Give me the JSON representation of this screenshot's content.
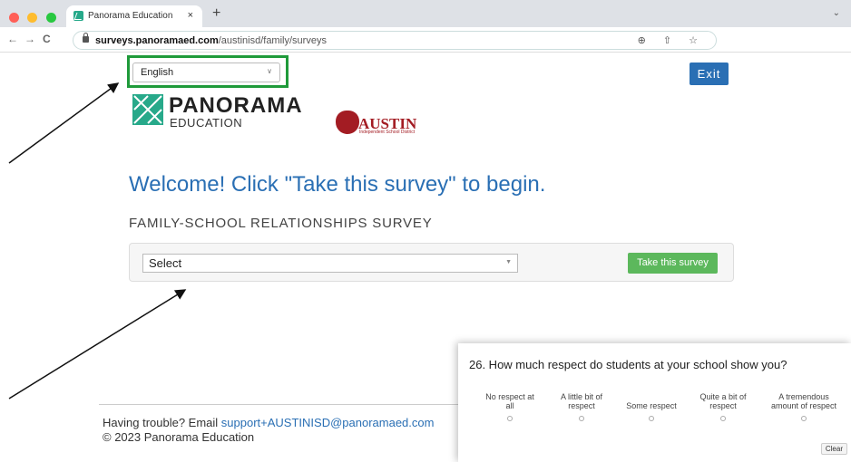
{
  "browser": {
    "tab_title": "Panorama Education",
    "tab_close": "×",
    "new_tab": "+",
    "url_host": "surveys.panoramaed.com",
    "url_path": "/austinisd/family/surveys",
    "nav_back": "←",
    "nav_forward": "→",
    "nav_reload": "C",
    "url_icons": "⊕ ⇧ ☆",
    "tab_menu": "⌄"
  },
  "language_select": {
    "value": "English"
  },
  "exit_label": "Exit",
  "logos": {
    "panorama_name": "PANORAMA",
    "panorama_sub": "EDUCATION",
    "austin_name": "AUSTIN",
    "austin_sub": "Independent School District"
  },
  "welcome_text": "Welcome! Click \"Take this survey\" to begin.",
  "survey_title": "FAMILY-SCHOOL RELATIONSHIPS SURVEY",
  "survey_select": {
    "value": "Select"
  },
  "take_survey_label": "Take this survey",
  "footer": {
    "trouble_prefix": "Having trouble? Email ",
    "support_email": "support+AUSTINISD@panoramaed.com",
    "copyright": "© 2023 Panorama Education"
  },
  "question": {
    "text": "26. How much respect do students at your school show you?",
    "options": [
      {
        "line1": "No respect at",
        "line2": "all"
      },
      {
        "line1": "A little bit of",
        "line2": "respect"
      },
      {
        "line1": "",
        "line2": "Some respect"
      },
      {
        "line1": "Quite a bit of",
        "line2": "respect"
      },
      {
        "line1": "A tremendous",
        "line2": "amount of respect"
      }
    ],
    "clear_label": "Clear"
  },
  "colors": {
    "accent_blue": "#2a6fb4",
    "highlight_green": "#1f9a3a",
    "button_green": "#5cb85c",
    "panorama_teal": "#27a98a",
    "austin_red": "#a31c23"
  }
}
